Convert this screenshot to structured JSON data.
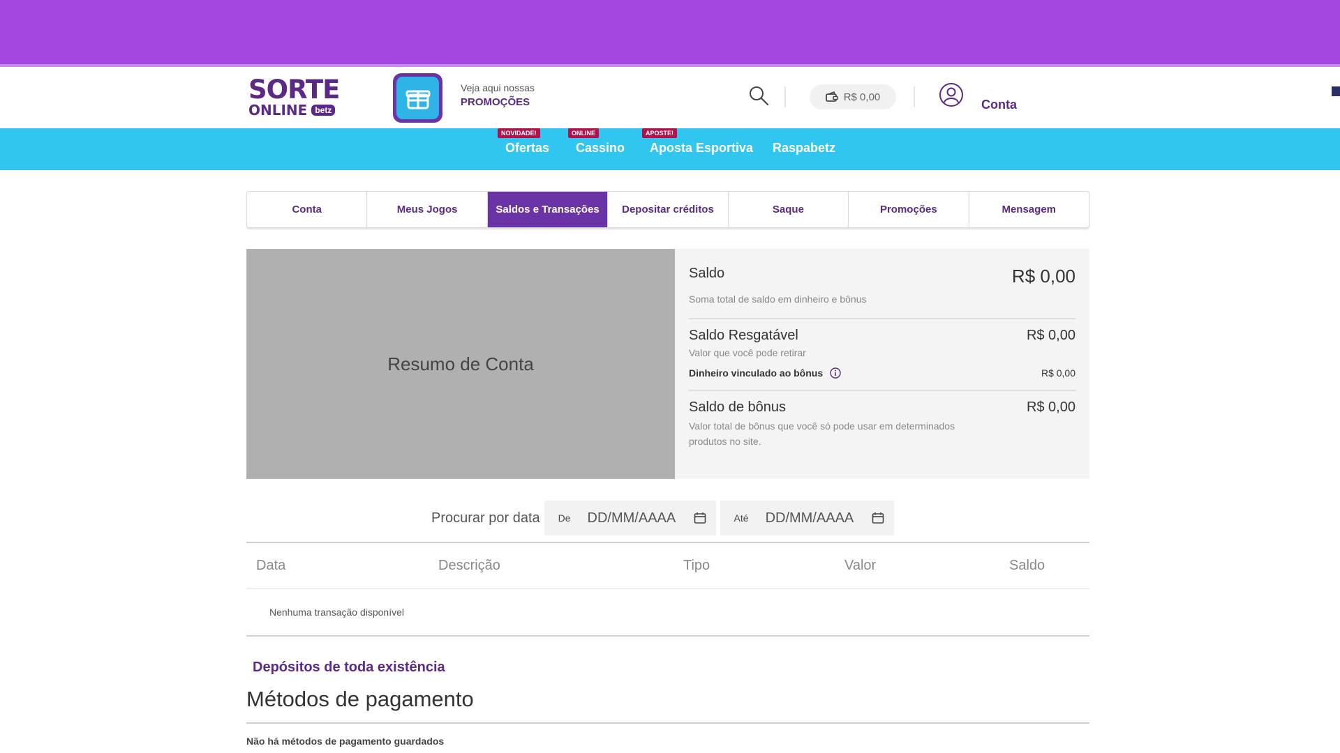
{
  "colors": {
    "top_band": "#a545e0",
    "brand_purple": "#5b2a86",
    "nav_blue": "#30c6f0",
    "active_tab": "#6a33a6",
    "badge_red": "#b0124c"
  },
  "header": {
    "logo": {
      "line1": "SORTE",
      "line2": "ONLINE",
      "badge": "betz"
    },
    "promo": {
      "line1": "Veja aqui nossas",
      "line2": "PROMOÇÕES"
    },
    "icons": [
      "gift-icon",
      "search-icon",
      "wallet-icon",
      "user-icon"
    ],
    "wallet_balance": "R$ 0,00",
    "account_label": "Conta"
  },
  "nav": {
    "items": [
      {
        "label": "Ofertas",
        "badge": "NOVIDADE!"
      },
      {
        "label": "Cassino",
        "badge": "ONLINE"
      },
      {
        "label": "Aposta Esportiva",
        "badge": "APOSTE!"
      },
      {
        "label": "Raspabetz",
        "badge": ""
      }
    ]
  },
  "tabs": [
    {
      "label": "Conta",
      "active": false
    },
    {
      "label": "Meus Jogos",
      "active": false
    },
    {
      "label": "Saldos e Transações",
      "active": true
    },
    {
      "label": "Depositar créditos",
      "active": false
    },
    {
      "label": "Saque",
      "active": false
    },
    {
      "label": "Promoções",
      "active": false
    },
    {
      "label": "Mensagem",
      "active": false
    }
  ],
  "summary": {
    "title": "Resumo de Conta",
    "saldo": {
      "label": "Saldo",
      "value": "R$ 0,00",
      "desc": "Soma total de saldo em dinheiro e bônus"
    },
    "resgatavel": {
      "label": "Saldo Resgatável",
      "value": "R$ 0,00",
      "desc": "Valor que você pode retirar"
    },
    "vinculado": {
      "label": "Dinheiro vinculado ao bônus",
      "value": "R$ 0,00"
    },
    "bonus": {
      "label": "Saldo de bônus",
      "value": "R$ 0,00",
      "desc": "Valor total de bônus que você só pode usar em determinados produtos no site."
    }
  },
  "date_search": {
    "label": "Procurar por data",
    "from_prefix": "De",
    "to_prefix": "Até",
    "placeholder": "DD/MM/AAAA"
  },
  "transactions": {
    "columns": [
      "Data",
      "Descrição",
      "Tipo",
      "Valor",
      "Saldo"
    ],
    "empty": "Nenhuma transação disponível"
  },
  "deposits_link": "Depósitos de toda existência",
  "payment_methods": {
    "title": "Métodos de pagamento",
    "empty": "Não há métodos de pagamento guardados"
  }
}
